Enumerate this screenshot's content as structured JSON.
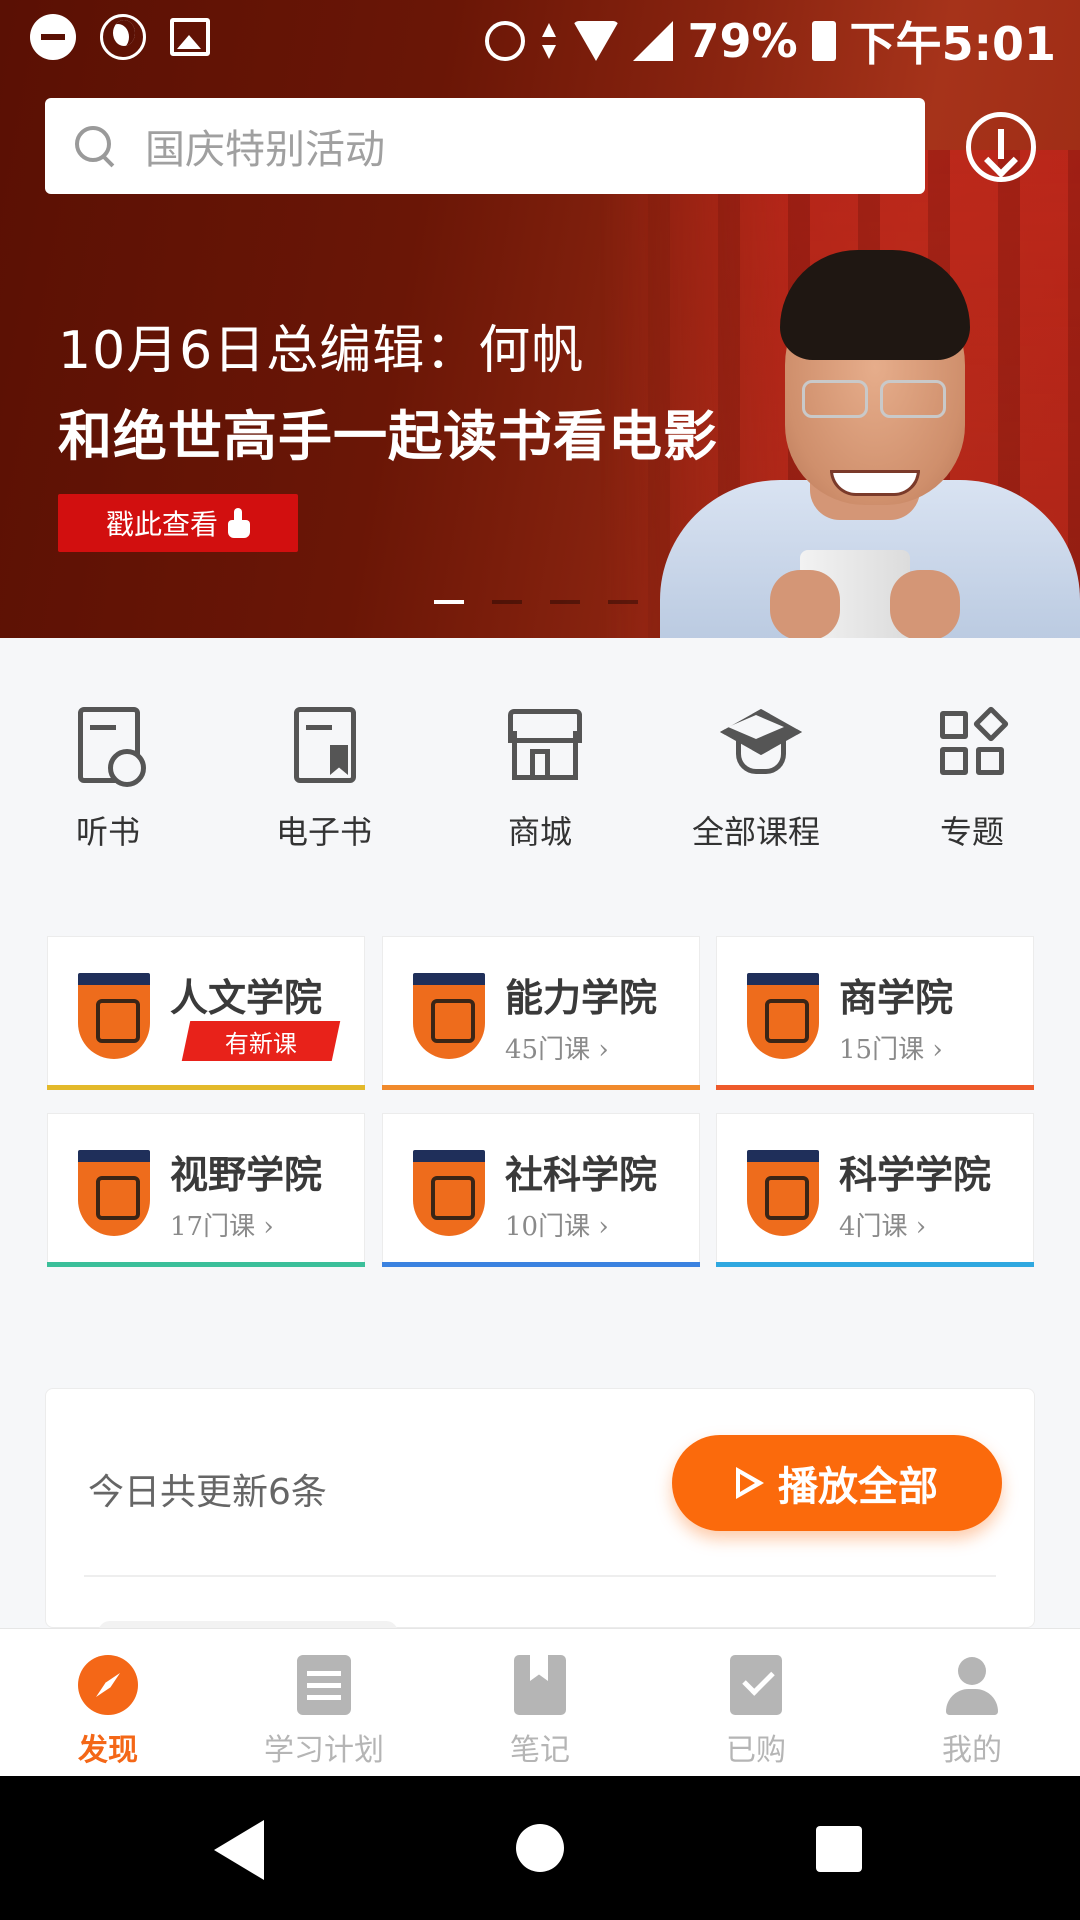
{
  "status_bar": {
    "battery": "79%",
    "time": "下午5:01",
    "left_icons": [
      "dnd-icon",
      "moon-icon",
      "image-icon"
    ],
    "right_icons": [
      "alarm-icon",
      "data-arrows-icon",
      "wifi-icon",
      "signal-icon",
      "battery-icon"
    ]
  },
  "search": {
    "placeholder": "国庆特别活动"
  },
  "banner": {
    "line1": "10月6日总编辑：何帆",
    "line2": "和绝世高手一起读书看电影",
    "button_label": "戳此查看",
    "slide_count": 4,
    "active_slide": 1
  },
  "quick_nav": [
    {
      "label": "听书",
      "icon": "listen-book-icon"
    },
    {
      "label": "电子书",
      "icon": "ebook-icon"
    },
    {
      "label": "商城",
      "icon": "store-icon"
    },
    {
      "label": "全部课程",
      "icon": "graduation-cap-icon"
    },
    {
      "label": "专题",
      "icon": "topics-grid-icon"
    }
  ],
  "academies": [
    {
      "name": "人文学院",
      "count": "",
      "badge": "有新课",
      "color": "#e3b92a"
    },
    {
      "name": "能力学院",
      "count": "45门课 ›",
      "badge": "",
      "color": "#f18a2c"
    },
    {
      "name": "商学院",
      "count": "15门课 ›",
      "badge": "",
      "color": "#ee5a2b"
    },
    {
      "name": "视野学院",
      "count": "17门课 ›",
      "badge": "",
      "color": "#3bbf9a"
    },
    {
      "name": "社科学院",
      "count": "10门课 ›",
      "badge": "",
      "color": "#3b82e0"
    },
    {
      "name": "科学学院",
      "count": "4门课 ›",
      "badge": "",
      "color": "#2fa8e0"
    }
  ],
  "updates": {
    "text": "今日共更新6条",
    "play_all_label": "播放全部"
  },
  "tabs": [
    {
      "label": "发现",
      "active": true
    },
    {
      "label": "学习计划",
      "active": false
    },
    {
      "label": "笔记",
      "active": false
    },
    {
      "label": "已购",
      "active": false
    },
    {
      "label": "我的",
      "active": false
    }
  ],
  "colors": {
    "accent": "#f46717",
    "banner_red": "#d20f0f",
    "play_button": "#fb6a0c"
  }
}
